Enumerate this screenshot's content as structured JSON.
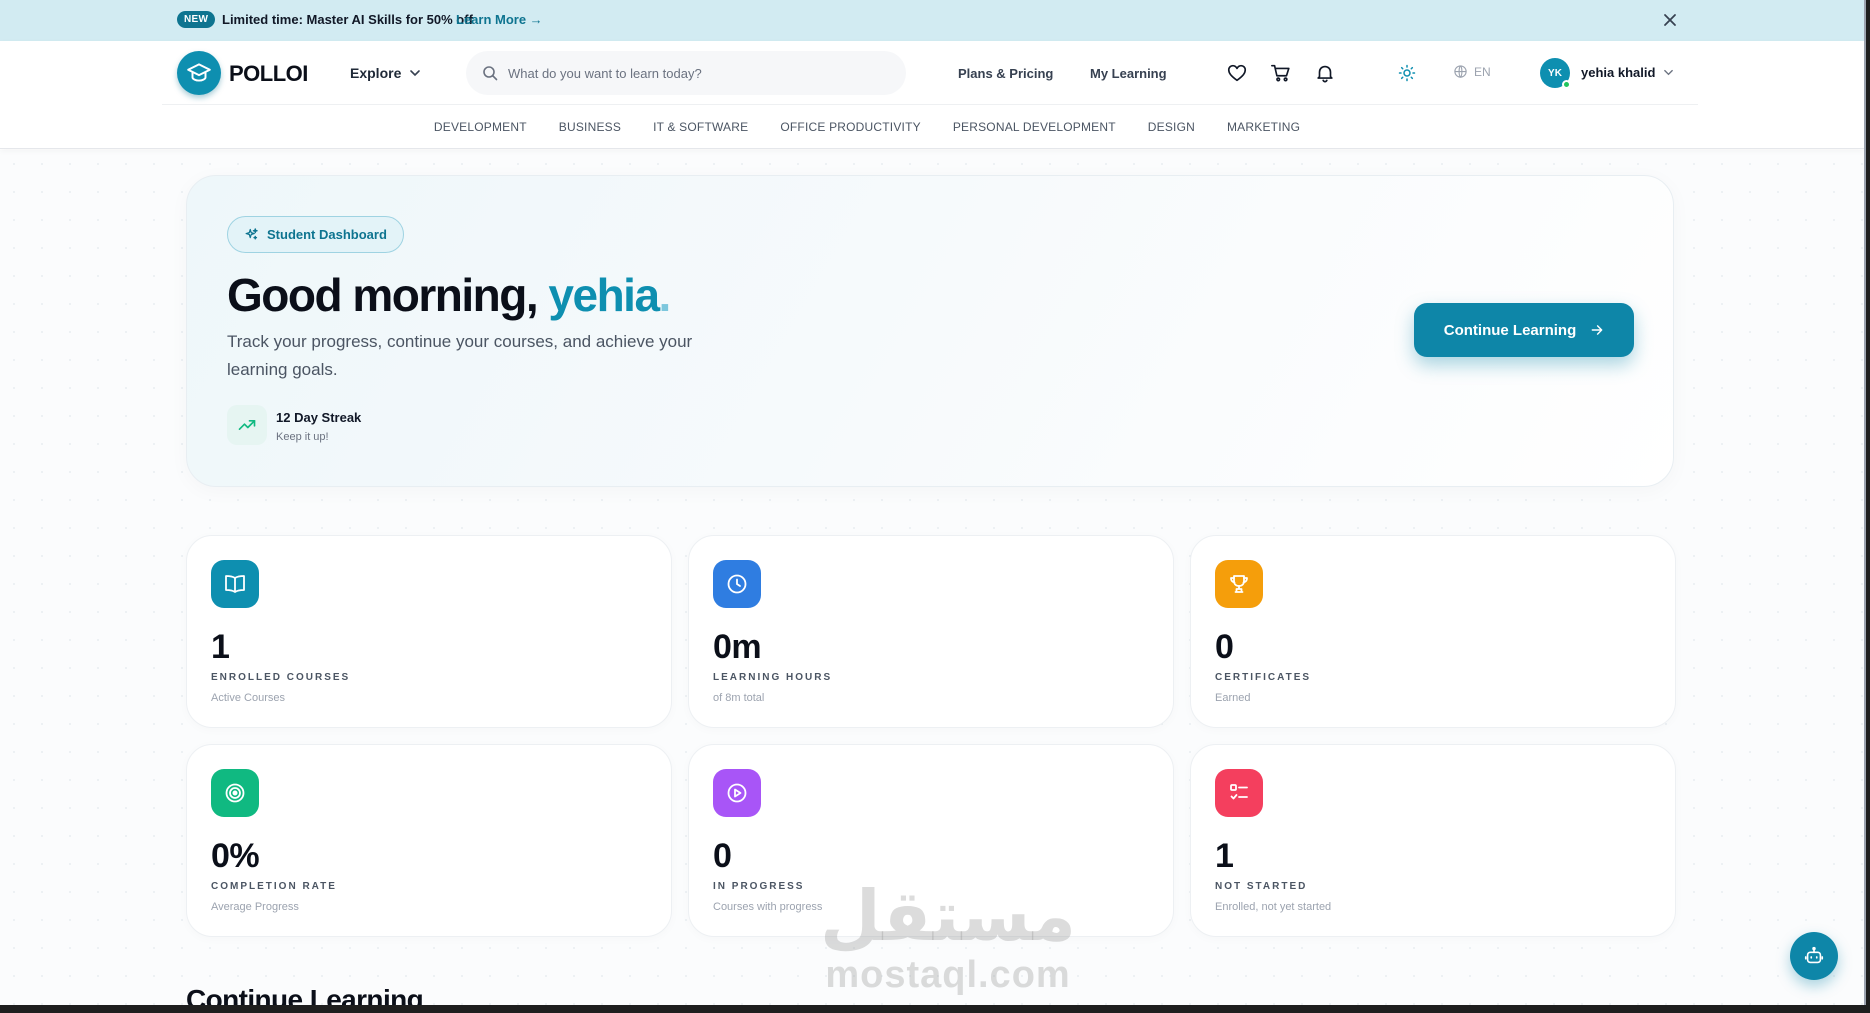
{
  "announcement": {
    "badge": "NEW",
    "message": "Limited time: Master AI Skills for 50% off",
    "link": "Learn More →"
  },
  "header": {
    "logo": "POLLOI",
    "explore": "Explore",
    "search_placeholder": "What do you want to learn today?",
    "plans": "Plans & Pricing",
    "my_learning": "My Learning",
    "language": "EN",
    "avatar_initials": "YK",
    "user_name": "yehia khalid"
  },
  "categories": [
    "DEVELOPMENT",
    "BUSINESS",
    "IT & SOFTWARE",
    "OFFICE PRODUCTIVITY",
    "PERSONAL DEVELOPMENT",
    "DESIGN",
    "MARKETING"
  ],
  "hero": {
    "pill": "Student Dashboard",
    "greeting": "Good morning, ",
    "name": "yehia",
    "dot": ".",
    "subtitle": "Track your progress, continue your courses, and achieve your learning goals.",
    "streak_title": "12 Day Streak",
    "streak_sub": "Keep it up!",
    "cta": "Continue Learning"
  },
  "stats": [
    {
      "value": "1",
      "label": "ENROLLED COURSES",
      "sub": "Active Courses",
      "icon": "book-icon",
      "color": "#0e8fb0"
    },
    {
      "value": "0m",
      "label": "LEARNING HOURS",
      "sub": "of 8m total",
      "icon": "clock-icon",
      "color": "#2f7de1"
    },
    {
      "value": "0",
      "label": "CERTIFICATES",
      "sub": "Earned",
      "icon": "trophy-icon",
      "color": "#f59e0b"
    },
    {
      "value": "0%",
      "label": "COMPLETION RATE",
      "sub": "Average Progress",
      "icon": "target-icon",
      "color": "#10b981"
    },
    {
      "value": "0",
      "label": "IN PROGRESS",
      "sub": "Courses with progress",
      "icon": "play-circle-icon",
      "color": "#a855f7"
    },
    {
      "value": "1",
      "label": "NOT STARTED",
      "sub": "Enrolled, not yet started",
      "icon": "list-check-icon",
      "color": "#f43f5e"
    }
  ],
  "section": {
    "title": "Continue Learning"
  },
  "watermark": {
    "arabic": "مستقل",
    "latin": "mostaql.com"
  }
}
